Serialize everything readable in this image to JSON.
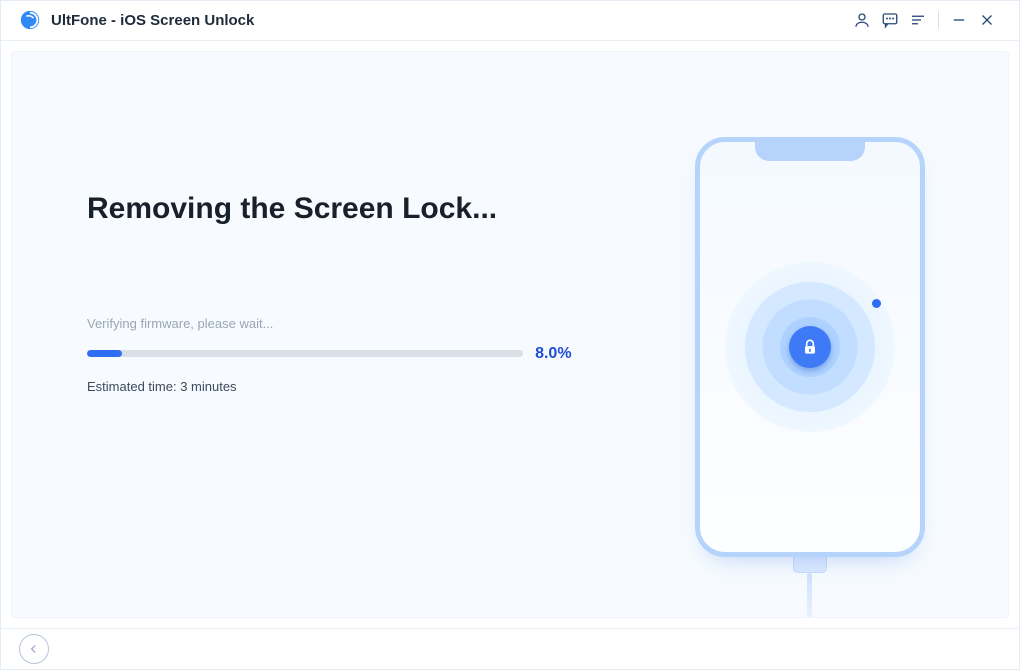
{
  "app": {
    "title": "UltFone - iOS Screen Unlock"
  },
  "titlebar": {
    "icons": {
      "user": "user-icon",
      "feedback": "feedback-icon",
      "menu": "menu-icon",
      "minimize": "minimize-icon",
      "close": "close-icon"
    }
  },
  "main": {
    "heading": "Removing the Screen Lock...",
    "status": "Verifying firmware, please wait...",
    "progress_percent_label": "8.0%",
    "progress_percent_value": 8.0,
    "estimated_time": "Estimated time: 3 minutes"
  },
  "illustration": {
    "device": "iphone",
    "center_icon": "lock-icon"
  },
  "footer": {
    "back": "back-button"
  },
  "colors": {
    "accent": "#2f6df3",
    "text_dark": "#17202b",
    "text_muted": "#9aa6b5",
    "panel_bg": "#f7fbff"
  }
}
